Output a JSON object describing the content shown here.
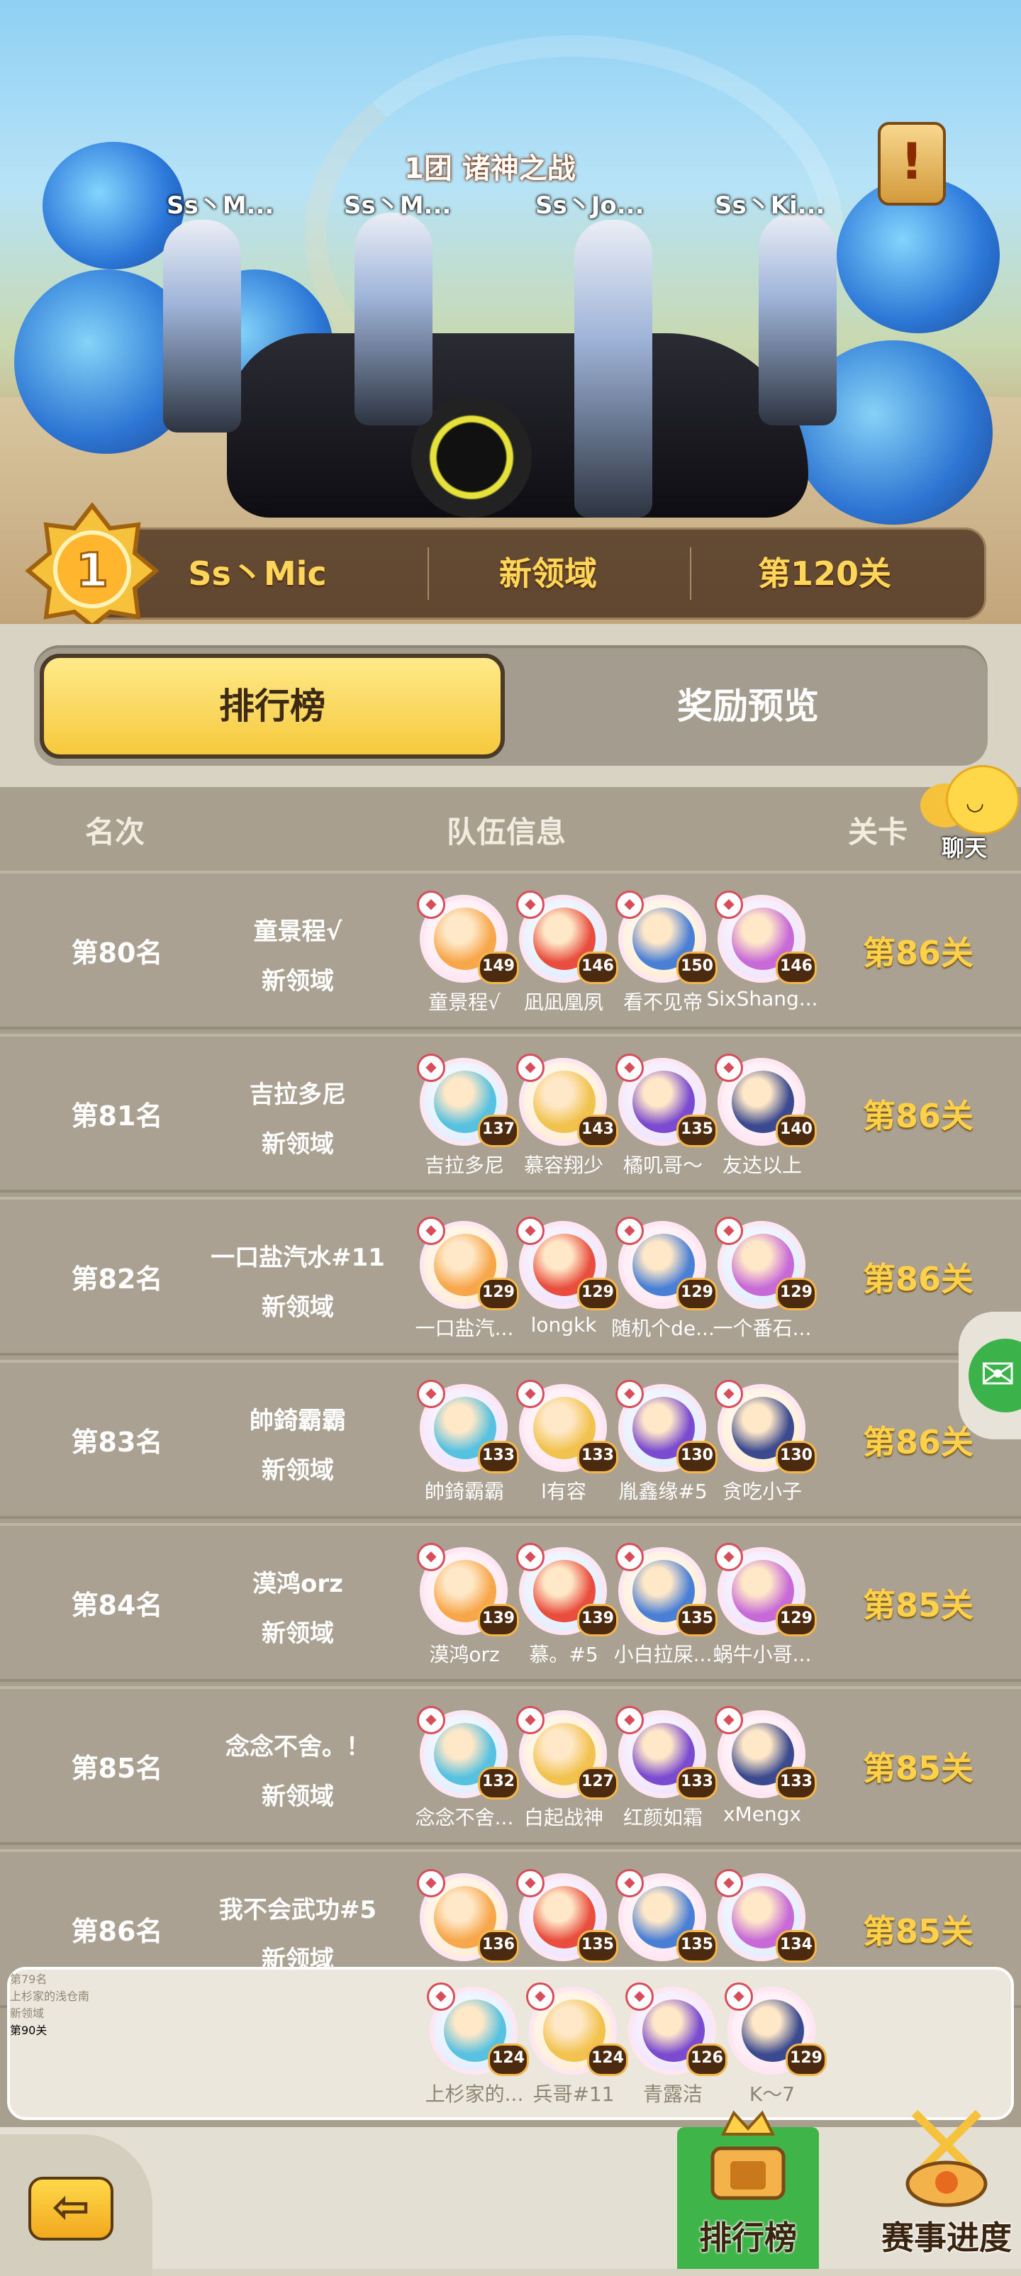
{
  "banner": {
    "guild_title": "1团 诸神之战",
    "players": [
      "Ss丶M...",
      "Ss丶M...",
      "Ss丶Jo...",
      "Ss丶Ki..."
    ],
    "info_icon": "exclamation-scroll-icon",
    "champion": {
      "rank": "1",
      "name": "Ss丶Mic",
      "server": "新领域",
      "stage": "第120关"
    }
  },
  "tabs": {
    "active": "排行榜",
    "inactive": "奖励预览"
  },
  "columns": {
    "rank": "名次",
    "team": "队伍信息",
    "stage": "关卡"
  },
  "chat_label": "聊天",
  "rows": [
    {
      "rank": "第80名",
      "team": "童景程√",
      "server": "新领域",
      "stage": "第86关",
      "members": [
        {
          "name": "童景程√",
          "level": "149"
        },
        {
          "name": "凪凪凰夙",
          "level": "146"
        },
        {
          "name": "看不见帝",
          "level": "150"
        },
        {
          "name": "SixShang...",
          "level": "146"
        }
      ]
    },
    {
      "rank": "第81名",
      "team": "吉拉多尼",
      "server": "新领域",
      "stage": "第86关",
      "members": [
        {
          "name": "吉拉多尼",
          "level": "137"
        },
        {
          "name": "慕容翔少",
          "level": "143"
        },
        {
          "name": "橘叽哥～",
          "level": "135"
        },
        {
          "name": "友达以上",
          "level": "140"
        }
      ]
    },
    {
      "rank": "第82名",
      "team": "一口盐汽水#11",
      "server": "新领域",
      "stage": "第86关",
      "members": [
        {
          "name": "一口盐汽...",
          "level": "129"
        },
        {
          "name": "longkk",
          "level": "129"
        },
        {
          "name": "随机个de...",
          "level": "129"
        },
        {
          "name": "一个番石...",
          "level": "129"
        }
      ]
    },
    {
      "rank": "第83名",
      "team": "帥錡霸霸",
      "server": "新领域",
      "stage": "第86关",
      "members": [
        {
          "name": "帥錡霸霸",
          "level": "133"
        },
        {
          "name": "l有容",
          "level": "133"
        },
        {
          "name": "胤鑫缘#5",
          "level": "130"
        },
        {
          "name": "贪吃小子",
          "level": "130"
        }
      ]
    },
    {
      "rank": "第84名",
      "team": "漠鸿orz",
      "server": "新领域",
      "stage": "第85关",
      "members": [
        {
          "name": "漠鸿orz",
          "level": "139"
        },
        {
          "name": "慕。#5",
          "level": "139"
        },
        {
          "name": "小白拉屎...",
          "level": "135"
        },
        {
          "name": "蜗牛小哥...",
          "level": "129"
        }
      ]
    },
    {
      "rank": "第85名",
      "team": "念念不舍。！",
      "server": "新领域",
      "stage": "第85关",
      "members": [
        {
          "name": "念念不舍...",
          "level": "132"
        },
        {
          "name": "白起战神",
          "level": "127"
        },
        {
          "name": "红颜如霜",
          "level": "133"
        },
        {
          "name": "xMengx",
          "level": "133"
        }
      ]
    },
    {
      "rank": "第86名",
      "team": "我不会武功#5",
      "server": "新领域",
      "stage": "第85关",
      "members": [
        {
          "name": "",
          "level": "136"
        },
        {
          "name": "",
          "level": "135"
        },
        {
          "name": "",
          "level": "135"
        },
        {
          "name": "",
          "level": "134"
        }
      ]
    }
  ],
  "my_row": {
    "rank": "第79名",
    "team": "上杉家的浅仓南",
    "server": "新领域",
    "stage": "第90关",
    "members": [
      {
        "name": "上杉家的...",
        "level": "124"
      },
      {
        "name": "兵哥#11",
        "level": "124"
      },
      {
        "name": "青露洁",
        "level": "126"
      },
      {
        "name": "K～7",
        "level": "129"
      }
    ]
  },
  "nav": {
    "back_icon": "back-arrow-icon",
    "leaderboard": "排行榜",
    "progress": "赛事进度"
  },
  "colors": {
    "gold": "#ffd04a",
    "tab_active": "#f6c93c",
    "row": "#aaa192"
  }
}
